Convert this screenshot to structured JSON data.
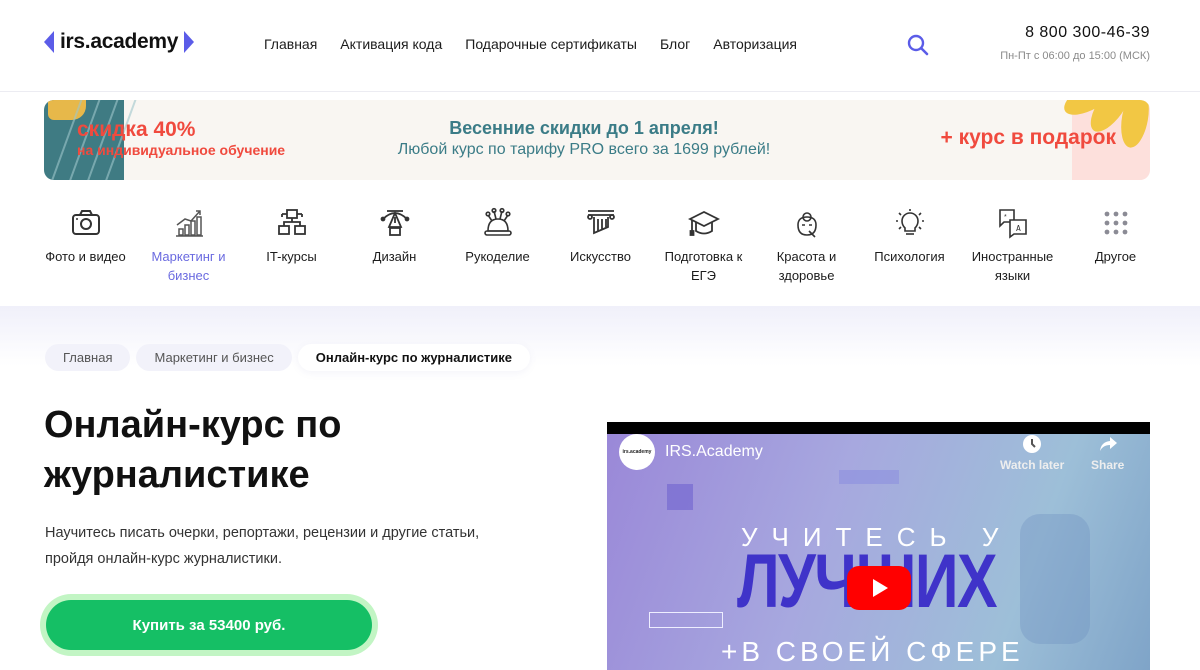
{
  "header": {
    "logo_text": "irs.academy",
    "nav": [
      "Главная",
      "Активация кода",
      "Подарочные сертификаты",
      "Блог",
      "Авторизация"
    ],
    "phone": "8 800 300-46-39",
    "hours": "Пн-Пт с 06:00 до 15:00 (МСК)",
    "accent_color": "#5b5ce8"
  },
  "promo": {
    "left_big": "скидка 40%",
    "left_small": "на индивидуальное обучение",
    "center_title": "Весенние скидки до 1 апреля!",
    "center_sub": "Любой курс по тарифу PRO всего за 1699 рублей!",
    "right_text": "+ курс в подарок"
  },
  "categories": [
    {
      "label": "Фото и видео",
      "icon": "camera-icon"
    },
    {
      "label": "Маркетинг и бизнес",
      "icon": "chart-growth-icon",
      "active": true
    },
    {
      "label": "IT-курсы",
      "icon": "network-icon"
    },
    {
      "label": "Дизайн",
      "icon": "pen-tool-icon"
    },
    {
      "label": "Рукоделие",
      "icon": "pincushion-icon"
    },
    {
      "label": "Искусство",
      "icon": "column-icon"
    },
    {
      "label": "Подготовка к ЕГЭ",
      "icon": "graduation-cap-icon"
    },
    {
      "label": "Красота и здоровье",
      "icon": "face-mask-icon"
    },
    {
      "label": "Психология",
      "icon": "lightbulb-icon"
    },
    {
      "label": "Иностранные языки",
      "icon": "translate-icon"
    },
    {
      "label": "Другое",
      "icon": "grid-dots-icon"
    }
  ],
  "breadcrumbs": [
    "Главная",
    "Маркетинг и бизнес",
    "Онлайн-курс по журналистике"
  ],
  "course": {
    "title": "Онлайн-курс по журналистике",
    "description": "Научитесь писать очерки, репортажи, рецензии и другие статьи, пройдя онлайн-курс журналистики.",
    "buy_label": "Купить за 53400 руб."
  },
  "video": {
    "channel": "IRS.Academy",
    "avatar_text": "irs.academy",
    "watch_later": "Watch later",
    "share": "Share",
    "line1": "УЧИТЕСЬ У",
    "line2": "ЛУЧШИХ",
    "line3": "+В СВОЕЙ СФЕРЕ"
  }
}
